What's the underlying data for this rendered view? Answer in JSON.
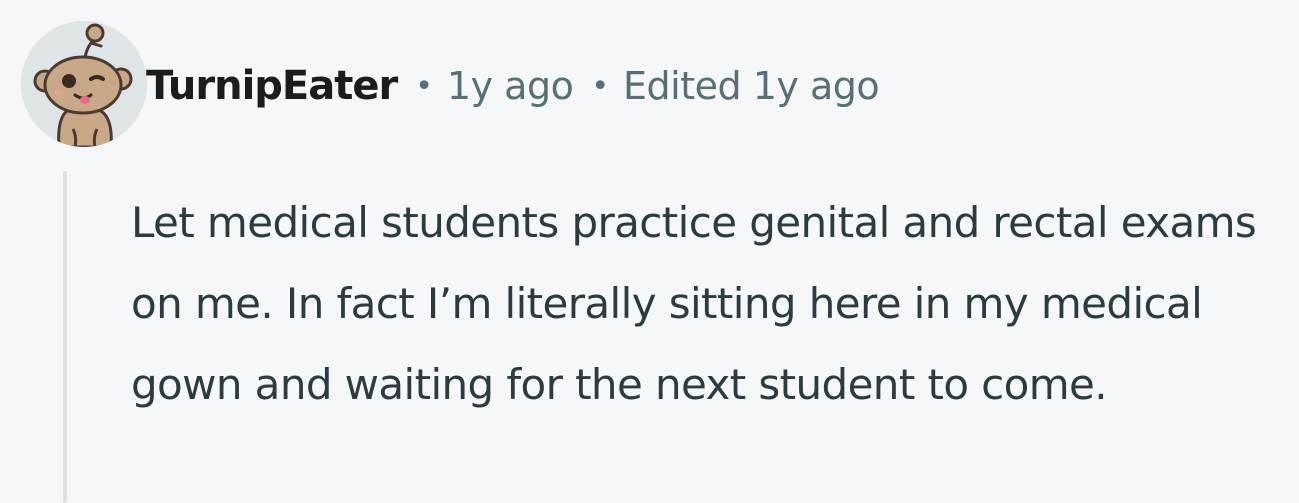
{
  "comment": {
    "author": "TurnipEater",
    "separator": "•",
    "posted_age": "1y ago",
    "edited_label": "Edited 1y ago",
    "avatar_icon": "snoo-mascot-wink-icon",
    "body": "Let medical students practice genital and rectal exams on me. In fact I’m literally sitting here in my medical gown and waiting for the next student to come."
  },
  "colors": {
    "background": "#f6f7f8",
    "meta_text": "#576f76",
    "body_text": "#2a3c42",
    "thread_line": "#dde1e4",
    "username": "#1c1c1c"
  }
}
